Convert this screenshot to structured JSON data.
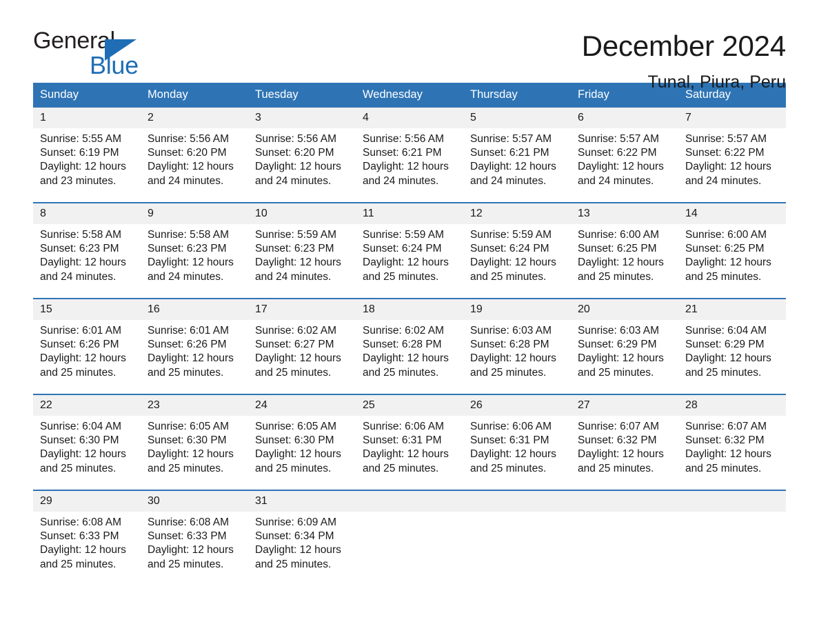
{
  "brand": {
    "name_dark": "General",
    "name_blue": "Blue",
    "accent_color": "#1f6eb5"
  },
  "header": {
    "title": "December 2024",
    "subtitle": "Tunal, Piura, Peru",
    "header_bg_color": "#2e74b5",
    "daynum_bg_color": "#f1f1f1"
  },
  "weekday_headers": [
    "Sunday",
    "Monday",
    "Tuesday",
    "Wednesday",
    "Thursday",
    "Friday",
    "Saturday"
  ],
  "labels": {
    "sunrise_prefix": "Sunrise:",
    "sunset_prefix": "Sunset:",
    "daylight_prefix": "Daylight:"
  },
  "weeks": [
    {
      "days": [
        {
          "num": "1",
          "sunrise": "Sunrise: 5:55 AM",
          "sunset": "Sunset: 6:19 PM",
          "daylight1": "Daylight: 12 hours",
          "daylight2": "and 23 minutes."
        },
        {
          "num": "2",
          "sunrise": "Sunrise: 5:56 AM",
          "sunset": "Sunset: 6:20 PM",
          "daylight1": "Daylight: 12 hours",
          "daylight2": "and 24 minutes."
        },
        {
          "num": "3",
          "sunrise": "Sunrise: 5:56 AM",
          "sunset": "Sunset: 6:20 PM",
          "daylight1": "Daylight: 12 hours",
          "daylight2": "and 24 minutes."
        },
        {
          "num": "4",
          "sunrise": "Sunrise: 5:56 AM",
          "sunset": "Sunset: 6:21 PM",
          "daylight1": "Daylight: 12 hours",
          "daylight2": "and 24 minutes."
        },
        {
          "num": "5",
          "sunrise": "Sunrise: 5:57 AM",
          "sunset": "Sunset: 6:21 PM",
          "daylight1": "Daylight: 12 hours",
          "daylight2": "and 24 minutes."
        },
        {
          "num": "6",
          "sunrise": "Sunrise: 5:57 AM",
          "sunset": "Sunset: 6:22 PM",
          "daylight1": "Daylight: 12 hours",
          "daylight2": "and 24 minutes."
        },
        {
          "num": "7",
          "sunrise": "Sunrise: 5:57 AM",
          "sunset": "Sunset: 6:22 PM",
          "daylight1": "Daylight: 12 hours",
          "daylight2": "and 24 minutes."
        }
      ]
    },
    {
      "days": [
        {
          "num": "8",
          "sunrise": "Sunrise: 5:58 AM",
          "sunset": "Sunset: 6:23 PM",
          "daylight1": "Daylight: 12 hours",
          "daylight2": "and 24 minutes."
        },
        {
          "num": "9",
          "sunrise": "Sunrise: 5:58 AM",
          "sunset": "Sunset: 6:23 PM",
          "daylight1": "Daylight: 12 hours",
          "daylight2": "and 24 minutes."
        },
        {
          "num": "10",
          "sunrise": "Sunrise: 5:59 AM",
          "sunset": "Sunset: 6:23 PM",
          "daylight1": "Daylight: 12 hours",
          "daylight2": "and 24 minutes."
        },
        {
          "num": "11",
          "sunrise": "Sunrise: 5:59 AM",
          "sunset": "Sunset: 6:24 PM",
          "daylight1": "Daylight: 12 hours",
          "daylight2": "and 25 minutes."
        },
        {
          "num": "12",
          "sunrise": "Sunrise: 5:59 AM",
          "sunset": "Sunset: 6:24 PM",
          "daylight1": "Daylight: 12 hours",
          "daylight2": "and 25 minutes."
        },
        {
          "num": "13",
          "sunrise": "Sunrise: 6:00 AM",
          "sunset": "Sunset: 6:25 PM",
          "daylight1": "Daylight: 12 hours",
          "daylight2": "and 25 minutes."
        },
        {
          "num": "14",
          "sunrise": "Sunrise: 6:00 AM",
          "sunset": "Sunset: 6:25 PM",
          "daylight1": "Daylight: 12 hours",
          "daylight2": "and 25 minutes."
        }
      ]
    },
    {
      "days": [
        {
          "num": "15",
          "sunrise": "Sunrise: 6:01 AM",
          "sunset": "Sunset: 6:26 PM",
          "daylight1": "Daylight: 12 hours",
          "daylight2": "and 25 minutes."
        },
        {
          "num": "16",
          "sunrise": "Sunrise: 6:01 AM",
          "sunset": "Sunset: 6:26 PM",
          "daylight1": "Daylight: 12 hours",
          "daylight2": "and 25 minutes."
        },
        {
          "num": "17",
          "sunrise": "Sunrise: 6:02 AM",
          "sunset": "Sunset: 6:27 PM",
          "daylight1": "Daylight: 12 hours",
          "daylight2": "and 25 minutes."
        },
        {
          "num": "18",
          "sunrise": "Sunrise: 6:02 AM",
          "sunset": "Sunset: 6:28 PM",
          "daylight1": "Daylight: 12 hours",
          "daylight2": "and 25 minutes."
        },
        {
          "num": "19",
          "sunrise": "Sunrise: 6:03 AM",
          "sunset": "Sunset: 6:28 PM",
          "daylight1": "Daylight: 12 hours",
          "daylight2": "and 25 minutes."
        },
        {
          "num": "20",
          "sunrise": "Sunrise: 6:03 AM",
          "sunset": "Sunset: 6:29 PM",
          "daylight1": "Daylight: 12 hours",
          "daylight2": "and 25 minutes."
        },
        {
          "num": "21",
          "sunrise": "Sunrise: 6:04 AM",
          "sunset": "Sunset: 6:29 PM",
          "daylight1": "Daylight: 12 hours",
          "daylight2": "and 25 minutes."
        }
      ]
    },
    {
      "days": [
        {
          "num": "22",
          "sunrise": "Sunrise: 6:04 AM",
          "sunset": "Sunset: 6:30 PM",
          "daylight1": "Daylight: 12 hours",
          "daylight2": "and 25 minutes."
        },
        {
          "num": "23",
          "sunrise": "Sunrise: 6:05 AM",
          "sunset": "Sunset: 6:30 PM",
          "daylight1": "Daylight: 12 hours",
          "daylight2": "and 25 minutes."
        },
        {
          "num": "24",
          "sunrise": "Sunrise: 6:05 AM",
          "sunset": "Sunset: 6:30 PM",
          "daylight1": "Daylight: 12 hours",
          "daylight2": "and 25 minutes."
        },
        {
          "num": "25",
          "sunrise": "Sunrise: 6:06 AM",
          "sunset": "Sunset: 6:31 PM",
          "daylight1": "Daylight: 12 hours",
          "daylight2": "and 25 minutes."
        },
        {
          "num": "26",
          "sunrise": "Sunrise: 6:06 AM",
          "sunset": "Sunset: 6:31 PM",
          "daylight1": "Daylight: 12 hours",
          "daylight2": "and 25 minutes."
        },
        {
          "num": "27",
          "sunrise": "Sunrise: 6:07 AM",
          "sunset": "Sunset: 6:32 PM",
          "daylight1": "Daylight: 12 hours",
          "daylight2": "and 25 minutes."
        },
        {
          "num": "28",
          "sunrise": "Sunrise: 6:07 AM",
          "sunset": "Sunset: 6:32 PM",
          "daylight1": "Daylight: 12 hours",
          "daylight2": "and 25 minutes."
        }
      ]
    },
    {
      "days": [
        {
          "num": "29",
          "sunrise": "Sunrise: 6:08 AM",
          "sunset": "Sunset: 6:33 PM",
          "daylight1": "Daylight: 12 hours",
          "daylight2": "and 25 minutes."
        },
        {
          "num": "30",
          "sunrise": "Sunrise: 6:08 AM",
          "sunset": "Sunset: 6:33 PM",
          "daylight1": "Daylight: 12 hours",
          "daylight2": "and 25 minutes."
        },
        {
          "num": "31",
          "sunrise": "Sunrise: 6:09 AM",
          "sunset": "Sunset: 6:34 PM",
          "daylight1": "Daylight: 12 hours",
          "daylight2": "and 25 minutes."
        },
        {
          "num": "",
          "sunrise": "",
          "sunset": "",
          "daylight1": "",
          "daylight2": ""
        },
        {
          "num": "",
          "sunrise": "",
          "sunset": "",
          "daylight1": "",
          "daylight2": ""
        },
        {
          "num": "",
          "sunrise": "",
          "sunset": "",
          "daylight1": "",
          "daylight2": ""
        },
        {
          "num": "",
          "sunrise": "",
          "sunset": "",
          "daylight1": "",
          "daylight2": ""
        }
      ]
    }
  ]
}
